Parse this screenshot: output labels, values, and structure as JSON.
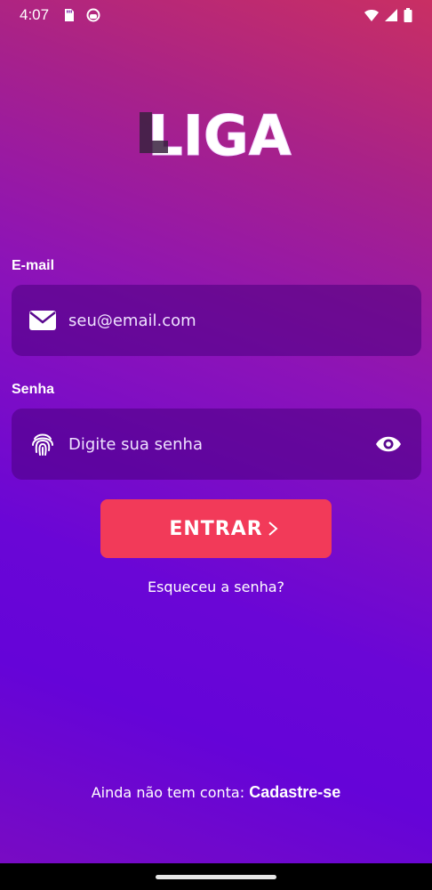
{
  "status_bar": {
    "time": "4:07",
    "left_icons": [
      "sd-card-icon",
      "notification-face-icon"
    ],
    "right_icons": [
      "wifi-icon",
      "cell-signal-icon",
      "battery-icon"
    ]
  },
  "logo": {
    "text": "LIGA"
  },
  "email": {
    "label": "E-mail",
    "placeholder": "seu@email.com",
    "icon": "envelope-icon"
  },
  "password": {
    "label": "Senha",
    "placeholder": "Digite sua senha",
    "icon": "fingerprint-icon",
    "toggle_icon": "eye-icon"
  },
  "login_button": {
    "label": "ENTRAR",
    "icon": "chevron-right-icon"
  },
  "forgot_link": "Esqueceu a senha?",
  "signup": {
    "prefix": "Ainda não tem conta: ",
    "link": "Cadastre-se"
  },
  "colors": {
    "accent": "#f23a59",
    "field_bg": "#4b007d",
    "gradient_top": "#c92f63",
    "gradient_bottom": "#6504d8"
  }
}
